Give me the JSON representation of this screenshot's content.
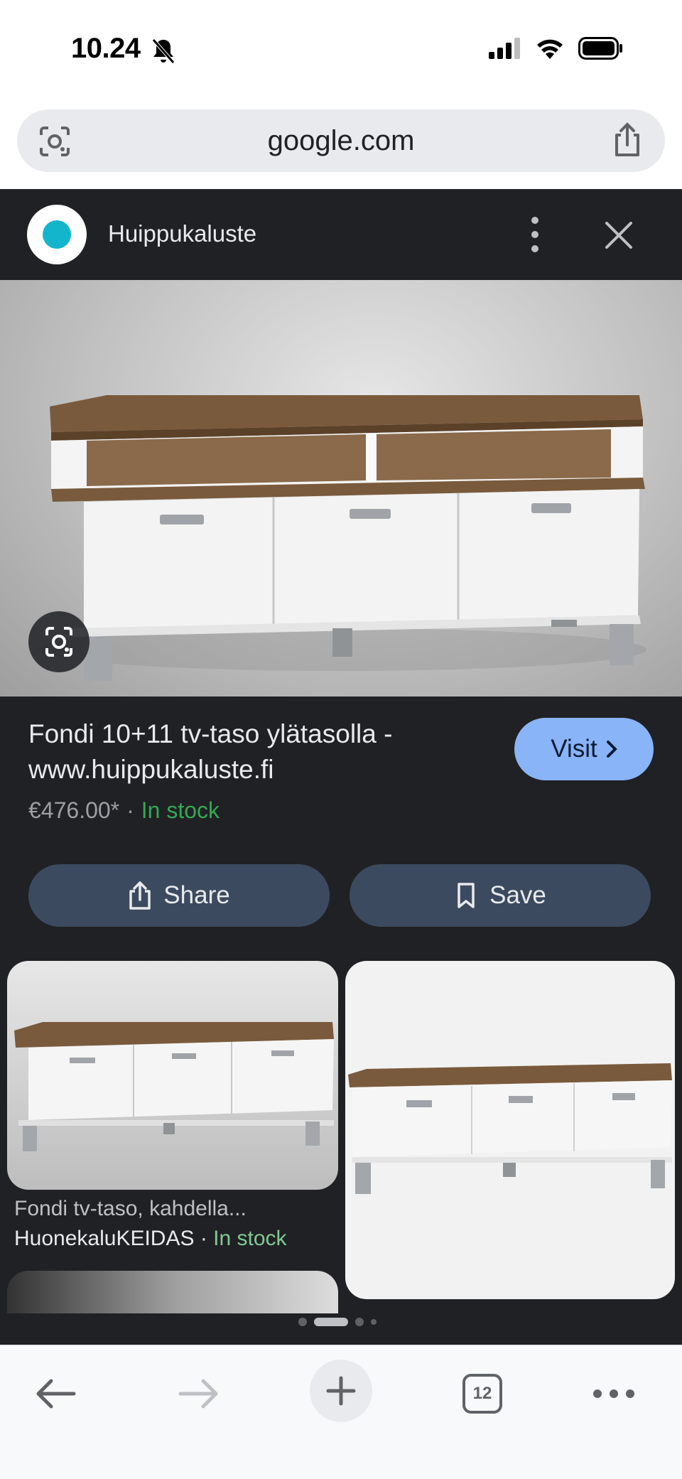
{
  "status_bar": {
    "time": "10.24",
    "icons": [
      "bell-off-icon",
      "cellular-signal-icon",
      "wifi-icon",
      "battery-icon"
    ]
  },
  "url_bar": {
    "url": "google.com",
    "left_icon": "lens-icon",
    "right_icon": "share-icon"
  },
  "result_panel": {
    "site_name": "Huippukaluste",
    "site_icon_color": "#12b5cb",
    "title": "Fondi 10+11 tv-taso ylätasolla - www.huippukaluste.fi",
    "visit_label": "Visit",
    "price": "€476.00*",
    "separator": "·",
    "stock": "In stock",
    "stock_color": "#34a853",
    "share_label": "Share",
    "save_label": "Save"
  },
  "related": [
    {
      "caption": "Fondi tv-taso, kahdella...",
      "source": "HuonekaluKEIDAS",
      "separator": " · ",
      "stock": "In stock"
    }
  ],
  "pager": {
    "pages": 4,
    "active_index": 1
  },
  "toolbar": {
    "back_icon": "back-arrow-icon",
    "forward_icon": "forward-arrow-icon",
    "new_tab_icon": "plus-icon",
    "tab_count": "12",
    "menu_icon": "more-horizontal-icon"
  },
  "colors": {
    "panel_bg": "#202124",
    "visit_button": "#8ab4f8",
    "action_button": "#3c4a5f"
  }
}
